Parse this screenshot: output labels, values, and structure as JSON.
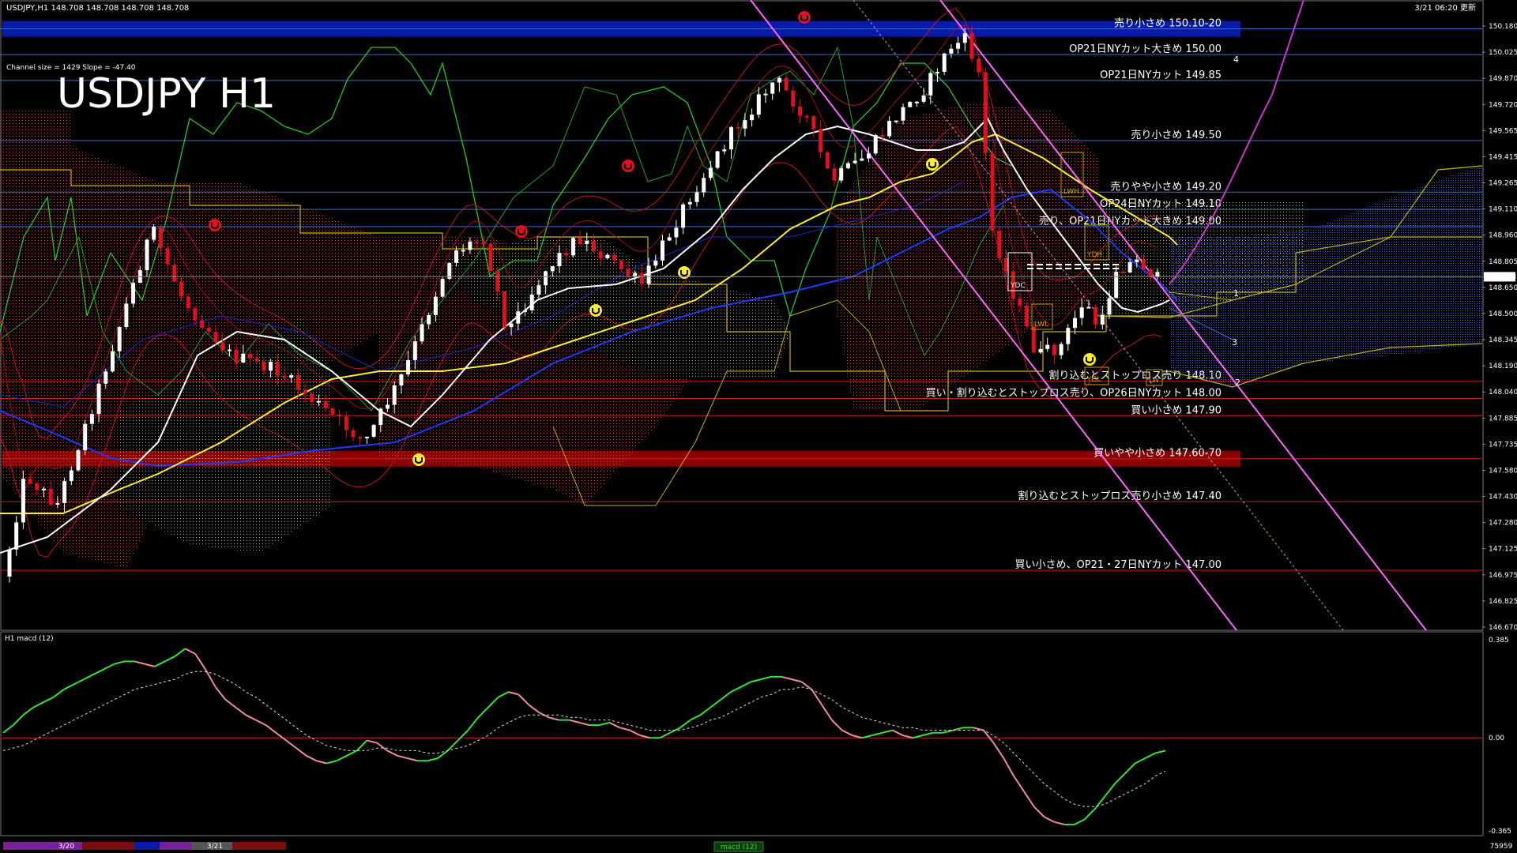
{
  "header": {
    "symbol_info": "USDJPY,H1  148.708 148.708 148.708 148.708",
    "timestamp": "3/21 06:20 更新",
    "channel_info": "Channel size = 1429  Slope = -47.40",
    "title": "USDJPY H1"
  },
  "colors": {
    "background": "#000000",
    "grid_blue": "#3a6fd8",
    "grid_red": "#c81e1e",
    "band_blue": "#0a1aa8",
    "band_red": "#8b0000",
    "candle_up": "#ffffff",
    "candle_down": "#e0101c",
    "macd_up": "#33e633",
    "macd_down": "#f08c9c",
    "ma_white": "#ffffff",
    "ma_yellow": "#ffee22",
    "ma_blue": "#1a3cff",
    "chikou": "#22cc22",
    "channel": "#ff66ff",
    "cloud_upper": "#c8b400"
  },
  "chart_data": [
    {
      "type": "candlestick",
      "title": "USDJPY H1",
      "ylim": [
        146.67,
        150.18
      ],
      "y_ticks": [
        "150.180",
        "150.025",
        "149.870",
        "149.720",
        "149.565",
        "149.415",
        "149.265",
        "149.110",
        "148.960",
        "148.805",
        "148.650",
        "148.500",
        "148.345",
        "148.190",
        "148.040",
        "147.885",
        "147.735",
        "147.580",
        "147.430",
        "147.280",
        "147.125",
        "146.975",
        "146.825",
        "146.670"
      ],
      "current_price": "148.708",
      "levels": [
        {
          "price": 150.15,
          "label": "売り小さめ 150.10-20",
          "kind": "band",
          "color": "blue"
        },
        {
          "price": 150.0,
          "label": "OP21日NYカット大きめ 150.00",
          "kind": "line",
          "color": "blue"
        },
        {
          "price": 149.85,
          "label": "OP21日NYカット 149.85",
          "kind": "line",
          "color": "blue"
        },
        {
          "price": 149.5,
          "label": "売り小さめ 149.50",
          "kind": "line",
          "color": "blue"
        },
        {
          "price": 149.2,
          "label": "売りやや小さめ 149.20",
          "kind": "line",
          "color": "blue"
        },
        {
          "price": 149.1,
          "label": "OP24日NYカット 149.10",
          "kind": "line",
          "color": "blue"
        },
        {
          "price": 149.0,
          "label": "売り、OP21日NYカット大きめ 149.00",
          "kind": "line",
          "color": "blue"
        },
        {
          "price": 148.1,
          "label": "割り込むとストップロス売り 148.10",
          "kind": "line",
          "color": "red"
        },
        {
          "price": 148.0,
          "label": "買い・割り込むとストップロス売り、OP26日NYカット 148.00",
          "kind": "line",
          "color": "red"
        },
        {
          "price": 147.9,
          "label": "買い小さめ 147.90",
          "kind": "line",
          "color": "red"
        },
        {
          "price": 147.65,
          "label": "買いやや小さめ 147.60-70",
          "kind": "band",
          "color": "red"
        },
        {
          "price": 147.4,
          "label": "割り込むとストップロス売り小さめ 147.40",
          "kind": "line",
          "color": "red"
        },
        {
          "price": 147.0,
          "label": "買い小さめ、OP21・27日NYカット 147.00",
          "kind": "line",
          "color": "red"
        }
      ],
      "annotations": [
        "LWH",
        "YDH",
        "YDC",
        "LWL",
        "YDL",
        "LW"
      ],
      "channel_labels": [
        "1",
        "2",
        "3",
        "4"
      ],
      "date_labels": [
        "3/20",
        "3/21"
      ]
    },
    {
      "type": "line",
      "title": "H1  macd (12)",
      "ylim": [
        -0.365,
        0.385
      ],
      "y_ticks": [
        "0.385",
        "0.00",
        "-0.365"
      ],
      "zero_line": 0,
      "series": [
        {
          "name": "macd",
          "values": [
            0.02,
            0.05,
            0.09,
            0.12,
            0.14,
            0.16,
            0.19,
            0.21,
            0.23,
            0.25,
            0.27,
            0.29,
            0.3,
            0.3,
            0.29,
            0.28,
            0.3,
            0.32,
            0.35,
            0.33,
            0.27,
            0.2,
            0.15,
            0.12,
            0.09,
            0.07,
            0.05,
            0.02,
            -0.01,
            -0.04,
            -0.07,
            -0.09,
            -0.1,
            -0.09,
            -0.07,
            -0.05,
            -0.01,
            -0.02,
            -0.05,
            -0.07,
            -0.08,
            -0.09,
            -0.09,
            -0.08,
            -0.05,
            -0.01,
            0.03,
            0.08,
            0.12,
            0.16,
            0.18,
            0.17,
            0.13,
            0.1,
            0.08,
            0.07,
            0.07,
            0.06,
            0.05,
            0.05,
            0.06,
            0.04,
            0.03,
            0.01,
            0.0,
            0.0,
            0.02,
            0.04,
            0.07,
            0.09,
            0.12,
            0.15,
            0.18,
            0.2,
            0.22,
            0.23,
            0.24,
            0.24,
            0.23,
            0.22,
            0.19,
            0.13,
            0.07,
            0.03,
            0.01,
            0.0,
            0.01,
            0.02,
            0.03,
            0.01,
            0.0,
            0.01,
            0.02,
            0.02,
            0.03,
            0.04,
            0.04,
            0.03,
            -0.02,
            -0.08,
            -0.15,
            -0.21,
            -0.27,
            -0.31,
            -0.33,
            -0.34,
            -0.34,
            -0.32,
            -0.28,
            -0.23,
            -0.18,
            -0.14,
            -0.1,
            -0.08,
            -0.06,
            -0.05
          ]
        },
        {
          "name": "signal",
          "values": [
            -0.05,
            -0.04,
            -0.03,
            -0.01,
            0.01,
            0.03,
            0.05,
            0.07,
            0.09,
            0.11,
            0.13,
            0.15,
            0.17,
            0.19,
            0.2,
            0.21,
            0.22,
            0.23,
            0.25,
            0.26,
            0.26,
            0.25,
            0.23,
            0.21,
            0.18,
            0.16,
            0.13,
            0.1,
            0.07,
            0.04,
            0.01,
            -0.01,
            -0.03,
            -0.04,
            -0.05,
            -0.05,
            -0.05,
            -0.04,
            -0.04,
            -0.05,
            -0.05,
            -0.05,
            -0.06,
            -0.06,
            -0.05,
            -0.04,
            -0.03,
            -0.01,
            0.01,
            0.04,
            0.06,
            0.08,
            0.09,
            0.09,
            0.09,
            0.09,
            0.08,
            0.08,
            0.07,
            0.07,
            0.07,
            0.06,
            0.05,
            0.04,
            0.03,
            0.03,
            0.03,
            0.03,
            0.04,
            0.05,
            0.07,
            0.08,
            0.1,
            0.12,
            0.14,
            0.16,
            0.17,
            0.19,
            0.19,
            0.2,
            0.19,
            0.17,
            0.15,
            0.12,
            0.1,
            0.08,
            0.07,
            0.06,
            0.05,
            0.04,
            0.04,
            0.03,
            0.03,
            0.03,
            0.03,
            0.03,
            0.03,
            0.03,
            0.01,
            -0.02,
            -0.06,
            -0.1,
            -0.14,
            -0.18,
            -0.21,
            -0.24,
            -0.26,
            -0.27,
            -0.27,
            -0.26,
            -0.24,
            -0.22,
            -0.2,
            -0.18,
            -0.15,
            -0.13
          ]
        }
      ]
    }
  ],
  "footer": {
    "date_labels": [
      "3/20",
      "3/21"
    ],
    "indicator_tab": "macd (12)",
    "volume": "75959"
  }
}
